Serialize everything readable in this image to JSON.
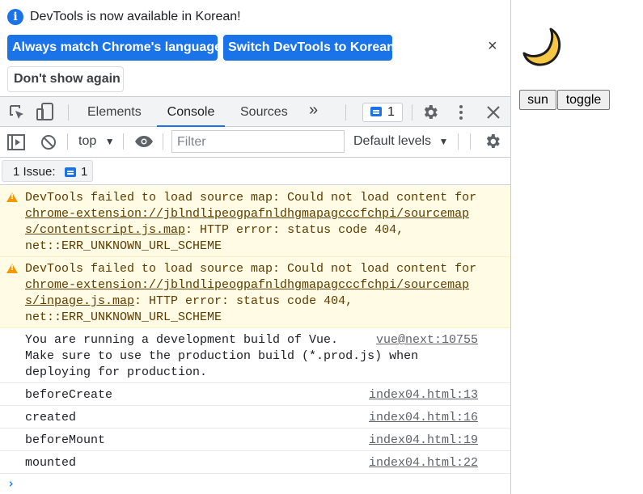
{
  "infobar": {
    "message": "DevTools is now available in Korean!",
    "btn_match": "Always match Chrome's language",
    "btn_switch": "Switch DevTools to Korean",
    "btn_dont_show": "Don't show again",
    "close": "×"
  },
  "tabs": [
    {
      "label": "Elements",
      "active": false
    },
    {
      "label": "Console",
      "active": true
    },
    {
      "label": "Sources",
      "active": false
    }
  ],
  "more_tabs": "»",
  "issues_count": "1",
  "console_toolbar": {
    "context": "top",
    "filter_placeholder": "Filter",
    "levels": "Default levels"
  },
  "issues_bar": {
    "label": "1 Issue:",
    "count": "1"
  },
  "messages": [
    {
      "level": "warning",
      "line1": "DevTools failed to load source map: Could not load content for",
      "link1": "chrome-extension://jblndlipeogpafnldhgmapagcccfchpi/sourcemap",
      "link2": "s/contentscript.js.map",
      "rest2": ": HTTP error: status code 404,",
      "line4": "net::ERR_UNKNOWN_URL_SCHEME"
    },
    {
      "level": "warning",
      "line1": "DevTools failed to load source map: Could not load content for",
      "link1": "chrome-extension://jblndlipeogpafnldhgmapagcccfchpi/sourcemap",
      "link2": "s/inpage.js.map",
      "rest2": ": HTTP error: status code 404,",
      "line4": "net::ERR_UNKNOWN_URL_SCHEME"
    },
    {
      "level": "info",
      "line1": "You are running a development build of Vue.",
      "line2": "Make sure to use the production build (*.prod.js) when",
      "line3": "deploying for production.",
      "source": "vue@next:10755"
    },
    {
      "level": "log",
      "text": "beforeCreate",
      "source": "index04.html:13"
    },
    {
      "level": "log",
      "text": "created",
      "source": "index04.html:16"
    },
    {
      "level": "log",
      "text": "beforeMount",
      "source": "index04.html:19"
    },
    {
      "level": "log",
      "text": "mounted",
      "source": "index04.html:22"
    }
  ],
  "prompt": "›",
  "page": {
    "btn_sun": "sun",
    "btn_toggle": "toggle",
    "icon": "crescent-moon-icon"
  },
  "colors": {
    "accent": "#1a73e8",
    "warning_bg": "#fffbe5",
    "moon": "#f6c744"
  }
}
